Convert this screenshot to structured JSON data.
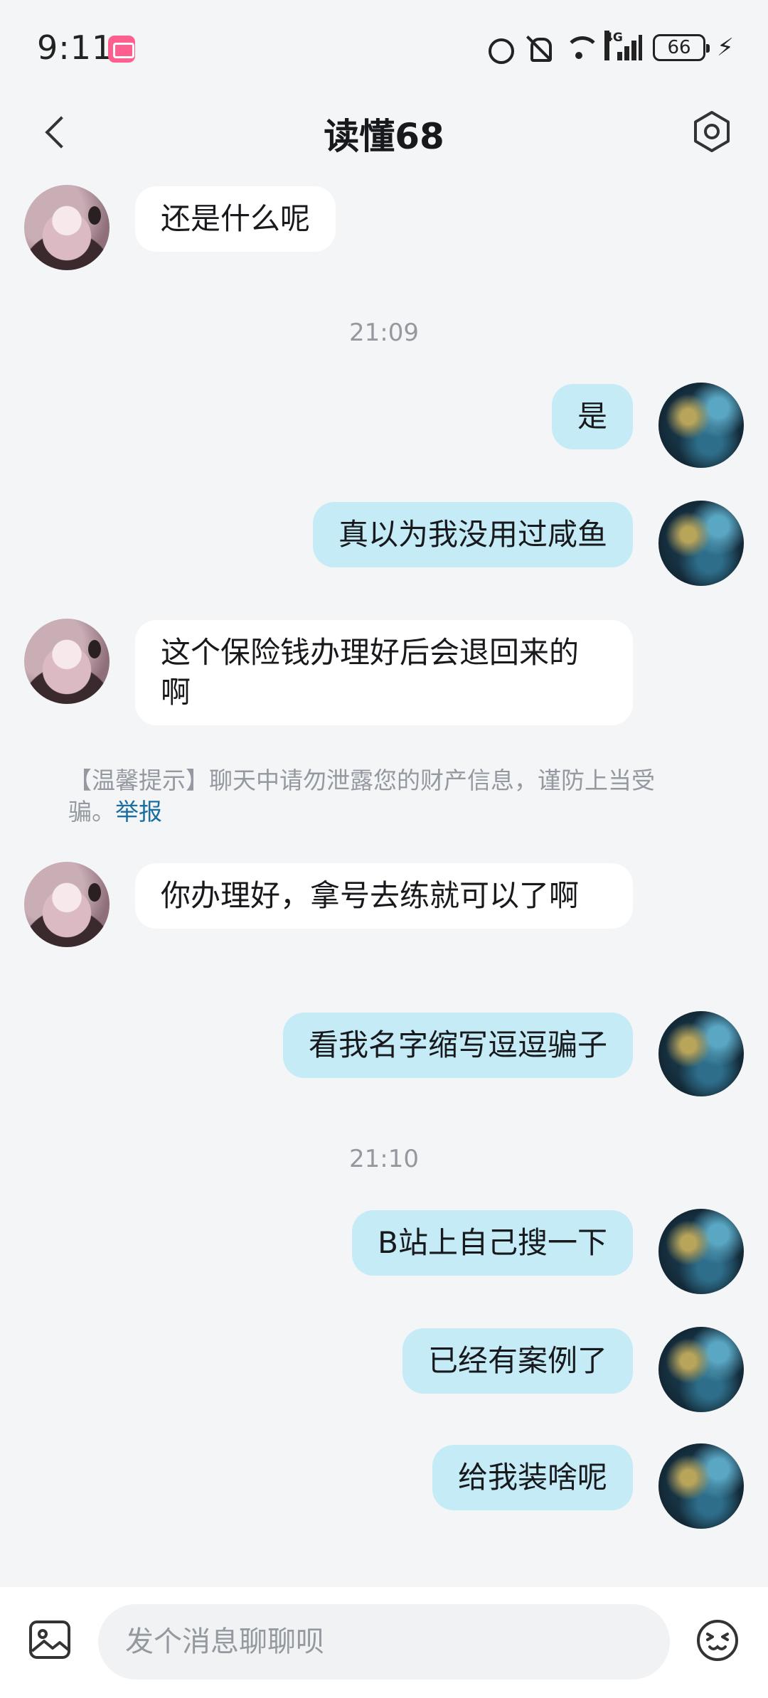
{
  "status_bar": {
    "time": "9:11",
    "network": "4G",
    "battery": "66"
  },
  "header": {
    "title": "读懂68"
  },
  "messages": [
    {
      "side": "left",
      "text": "还是什么呢"
    },
    {
      "side": "right",
      "text": "是"
    },
    {
      "side": "right",
      "text": "真以为我没用过咸鱼"
    },
    {
      "side": "left",
      "text": "这个保险钱办理好后会退回来的啊"
    },
    {
      "side": "left",
      "text": "你办理好，拿号去练就可以了啊"
    },
    {
      "side": "right",
      "text": "看我名字缩写逗逗骗子"
    },
    {
      "side": "right",
      "text": "B站上自己搜一下"
    },
    {
      "side": "right",
      "text": "已经有案例了"
    },
    {
      "side": "right",
      "text": "给我装啥呢"
    }
  ],
  "timestamps": [
    "21:09",
    "21:10"
  ],
  "notice": {
    "text": "【温馨提示】聊天中请勿泄露您的财产信息，谨防上当受骗。",
    "link": "举报"
  },
  "input": {
    "placeholder": "发个消息聊聊呗"
  },
  "icons": {
    "back": "chevron-left-icon",
    "settings": "hexagon-gear-icon",
    "image": "image-icon",
    "emoji": "emoji-icon"
  },
  "colors": {
    "background": "#f4f5f7",
    "bubble_self": "#c4ebf6",
    "bubble_other": "#ffffff",
    "muted_text": "#9499a0",
    "link": "#1a6fa0"
  }
}
